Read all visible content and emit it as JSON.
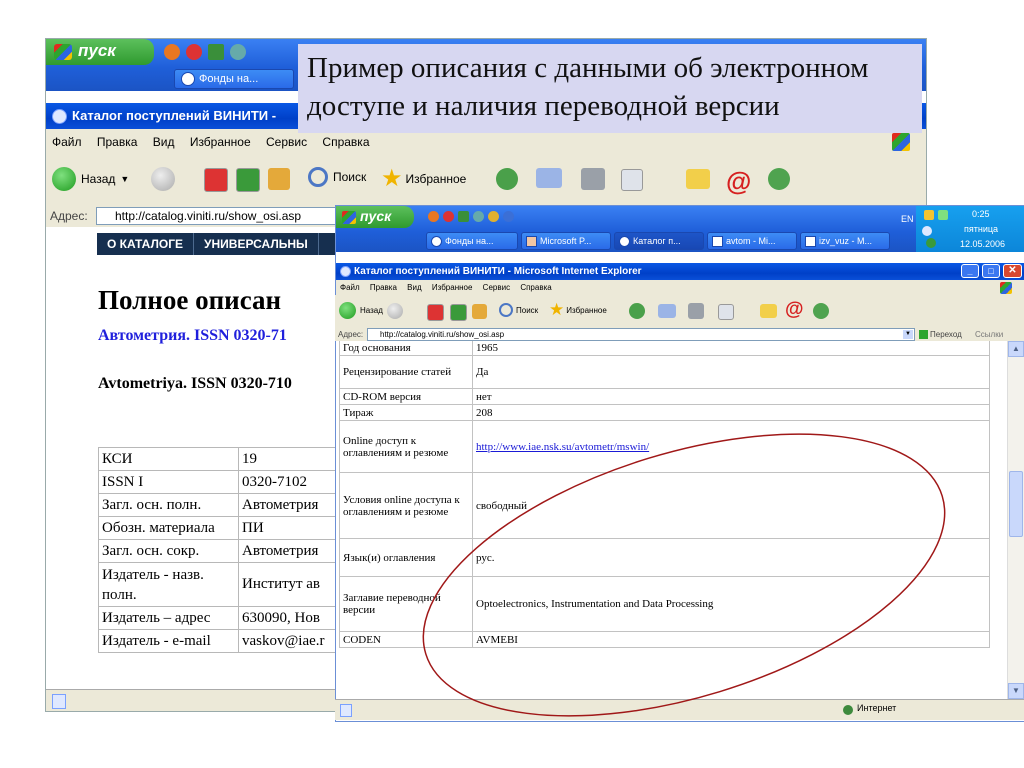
{
  "caption": {
    "line1": "Пример описания с данными об электронном",
    "line2": "доступе и наличия переводной версии"
  },
  "back_window": {
    "taskbar": {
      "start_label": "пуск",
      "task_label": "Фонды на..."
    },
    "title": "Каталог поступлений ВИНИТИ -",
    "menu": [
      "Файл",
      "Правка",
      "Вид",
      "Избранное",
      "Сервис",
      "Справка"
    ],
    "toolbar": {
      "back": "Назад",
      "search": "Поиск",
      "favorites": "Избранное"
    },
    "address": {
      "label": "Адрес:",
      "url": "http://catalog.viniti.ru/show_osi.asp"
    },
    "nav": [
      "О КАТАЛОГЕ",
      "УНИВЕРСАЛЬНЫ"
    ],
    "heading": "Полное описан",
    "link_title": "Автометрия. ISSN 0320-71",
    "subtitle": "Avtometriya. ISSN 0320-710",
    "rows": [
      {
        "label": "КСИ",
        "value": "19"
      },
      {
        "label": "ISSN I",
        "value": "0320-7102"
      },
      {
        "label": "Загл. осн. полн.",
        "value": "Автометрия"
      },
      {
        "label": "Обозн. материала",
        "value": "ПИ"
      },
      {
        "label": "Загл. осн. сокр.",
        "value": "Автометрия"
      },
      {
        "label": "Издатель - назв. полн.",
        "value": "Институт ав"
      },
      {
        "label": "Издатель – адрес",
        "value": "630090, Нов"
      },
      {
        "label": "Издатель - e-mail",
        "value": "vaskov@iae.r"
      }
    ]
  },
  "front_window": {
    "taskbar": {
      "start_label": "пуск",
      "tasks": [
        "Фонды на...",
        "Microsoft P...",
        "Каталог п...",
        "avtom - Mi...",
        "izv_vuz - M..."
      ],
      "lang": "EN",
      "time": "0:25",
      "weekday": "пятница",
      "date": "12.05.2006"
    },
    "title": "Каталог поступлений ВИНИТИ - Microsoft Internet Explorer",
    "menu": [
      "Файл",
      "Правка",
      "Вид",
      "Избранное",
      "Сервис",
      "Справка"
    ],
    "toolbar": {
      "back": "Назад",
      "search": "Поиск",
      "favorites": "Избранное"
    },
    "address": {
      "label": "Адрес:",
      "url": "http://catalog.viniti.ru/show_osi.asp",
      "go": "Переход",
      "links": "Ссылки"
    },
    "rows": [
      {
        "label": "Год основания",
        "value": "1965"
      },
      {
        "label": "Рецензирование статей",
        "value": "Да"
      },
      {
        "label": "CD-ROM версия",
        "value": "нет"
      },
      {
        "label": "Тираж",
        "value": "208"
      },
      {
        "label": "Online доступ к оглавлениям и резюме",
        "value": "http://www.iae.nsk.su/avtometr/mswin/",
        "is_link": true
      },
      {
        "label": "Условия online доступа к оглавлениям и резюме",
        "value": "свободный"
      },
      {
        "label": "Язык(и) оглавления",
        "value": "рус."
      },
      {
        "label": "Заглавие переводной версии",
        "value": "Optoelectronics, Instrumentation and Data Processing"
      },
      {
        "label": "CODEN",
        "value": "AVMEBI"
      }
    ],
    "status": "Интернет"
  },
  "colors": {
    "caption_bg": "#d7d7f1",
    "highlight_ellipse": "#a01818",
    "xp_title": "#0a4fd8",
    "link": "#1f1fdc"
  }
}
